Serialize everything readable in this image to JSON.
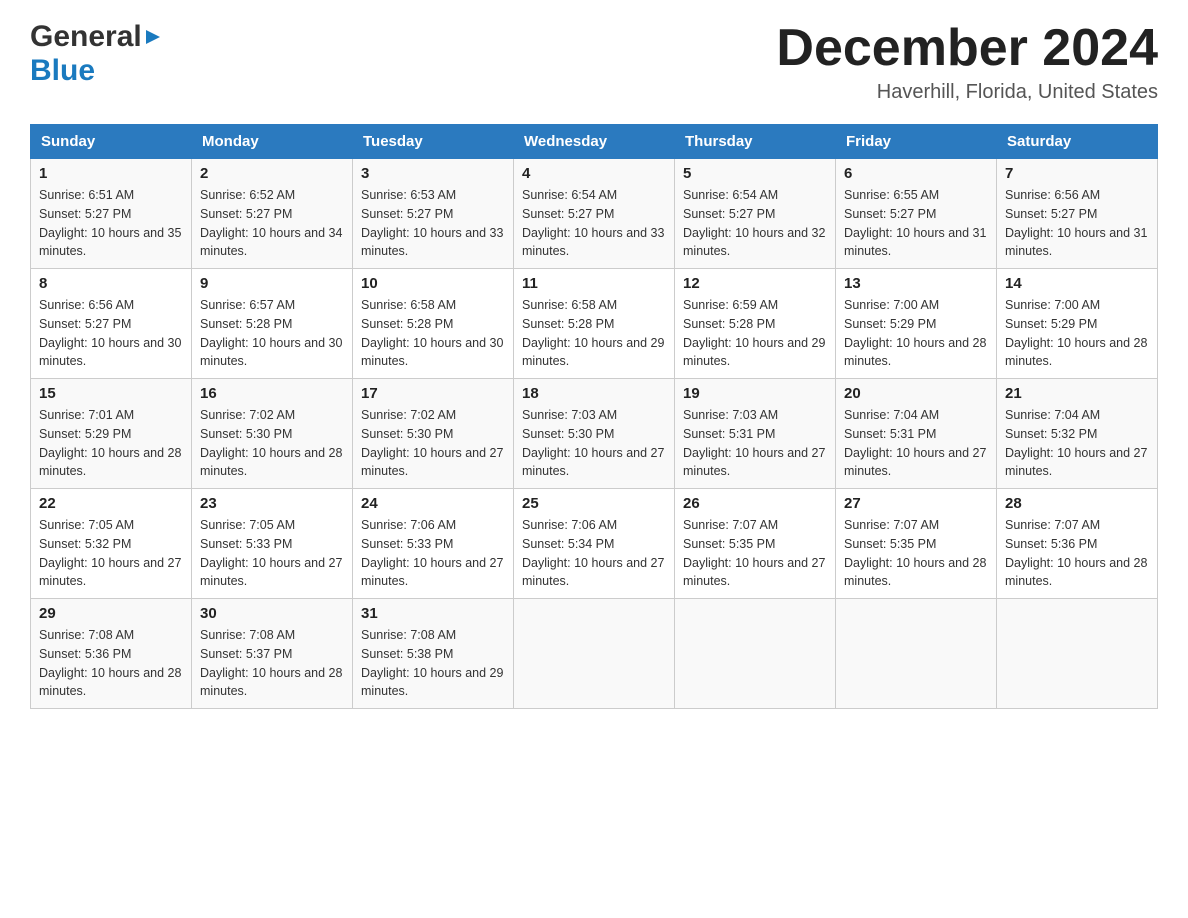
{
  "header": {
    "logo_general": "General",
    "logo_blue": "Blue",
    "month_year": "December 2024",
    "location": "Haverhill, Florida, United States"
  },
  "days_of_week": [
    "Sunday",
    "Monday",
    "Tuesday",
    "Wednesday",
    "Thursday",
    "Friday",
    "Saturday"
  ],
  "weeks": [
    [
      {
        "day": "1",
        "sunrise": "6:51 AM",
        "sunset": "5:27 PM",
        "daylight": "10 hours and 35 minutes."
      },
      {
        "day": "2",
        "sunrise": "6:52 AM",
        "sunset": "5:27 PM",
        "daylight": "10 hours and 34 minutes."
      },
      {
        "day": "3",
        "sunrise": "6:53 AM",
        "sunset": "5:27 PM",
        "daylight": "10 hours and 33 minutes."
      },
      {
        "day": "4",
        "sunrise": "6:54 AM",
        "sunset": "5:27 PM",
        "daylight": "10 hours and 33 minutes."
      },
      {
        "day": "5",
        "sunrise": "6:54 AM",
        "sunset": "5:27 PM",
        "daylight": "10 hours and 32 minutes."
      },
      {
        "day": "6",
        "sunrise": "6:55 AM",
        "sunset": "5:27 PM",
        "daylight": "10 hours and 31 minutes."
      },
      {
        "day": "7",
        "sunrise": "6:56 AM",
        "sunset": "5:27 PM",
        "daylight": "10 hours and 31 minutes."
      }
    ],
    [
      {
        "day": "8",
        "sunrise": "6:56 AM",
        "sunset": "5:27 PM",
        "daylight": "10 hours and 30 minutes."
      },
      {
        "day": "9",
        "sunrise": "6:57 AM",
        "sunset": "5:28 PM",
        "daylight": "10 hours and 30 minutes."
      },
      {
        "day": "10",
        "sunrise": "6:58 AM",
        "sunset": "5:28 PM",
        "daylight": "10 hours and 30 minutes."
      },
      {
        "day": "11",
        "sunrise": "6:58 AM",
        "sunset": "5:28 PM",
        "daylight": "10 hours and 29 minutes."
      },
      {
        "day": "12",
        "sunrise": "6:59 AM",
        "sunset": "5:28 PM",
        "daylight": "10 hours and 29 minutes."
      },
      {
        "day": "13",
        "sunrise": "7:00 AM",
        "sunset": "5:29 PM",
        "daylight": "10 hours and 28 minutes."
      },
      {
        "day": "14",
        "sunrise": "7:00 AM",
        "sunset": "5:29 PM",
        "daylight": "10 hours and 28 minutes."
      }
    ],
    [
      {
        "day": "15",
        "sunrise": "7:01 AM",
        "sunset": "5:29 PM",
        "daylight": "10 hours and 28 minutes."
      },
      {
        "day": "16",
        "sunrise": "7:02 AM",
        "sunset": "5:30 PM",
        "daylight": "10 hours and 28 minutes."
      },
      {
        "day": "17",
        "sunrise": "7:02 AM",
        "sunset": "5:30 PM",
        "daylight": "10 hours and 27 minutes."
      },
      {
        "day": "18",
        "sunrise": "7:03 AM",
        "sunset": "5:30 PM",
        "daylight": "10 hours and 27 minutes."
      },
      {
        "day": "19",
        "sunrise": "7:03 AM",
        "sunset": "5:31 PM",
        "daylight": "10 hours and 27 minutes."
      },
      {
        "day": "20",
        "sunrise": "7:04 AM",
        "sunset": "5:31 PM",
        "daylight": "10 hours and 27 minutes."
      },
      {
        "day": "21",
        "sunrise": "7:04 AM",
        "sunset": "5:32 PM",
        "daylight": "10 hours and 27 minutes."
      }
    ],
    [
      {
        "day": "22",
        "sunrise": "7:05 AM",
        "sunset": "5:32 PM",
        "daylight": "10 hours and 27 minutes."
      },
      {
        "day": "23",
        "sunrise": "7:05 AM",
        "sunset": "5:33 PM",
        "daylight": "10 hours and 27 minutes."
      },
      {
        "day": "24",
        "sunrise": "7:06 AM",
        "sunset": "5:33 PM",
        "daylight": "10 hours and 27 minutes."
      },
      {
        "day": "25",
        "sunrise": "7:06 AM",
        "sunset": "5:34 PM",
        "daylight": "10 hours and 27 minutes."
      },
      {
        "day": "26",
        "sunrise": "7:07 AM",
        "sunset": "5:35 PM",
        "daylight": "10 hours and 27 minutes."
      },
      {
        "day": "27",
        "sunrise": "7:07 AM",
        "sunset": "5:35 PM",
        "daylight": "10 hours and 28 minutes."
      },
      {
        "day": "28",
        "sunrise": "7:07 AM",
        "sunset": "5:36 PM",
        "daylight": "10 hours and 28 minutes."
      }
    ],
    [
      {
        "day": "29",
        "sunrise": "7:08 AM",
        "sunset": "5:36 PM",
        "daylight": "10 hours and 28 minutes."
      },
      {
        "day": "30",
        "sunrise": "7:08 AM",
        "sunset": "5:37 PM",
        "daylight": "10 hours and 28 minutes."
      },
      {
        "day": "31",
        "sunrise": "7:08 AM",
        "sunset": "5:38 PM",
        "daylight": "10 hours and 29 minutes."
      },
      null,
      null,
      null,
      null
    ]
  ],
  "labels": {
    "sunrise_prefix": "Sunrise: ",
    "sunset_prefix": "Sunset: ",
    "daylight_prefix": "Daylight: "
  }
}
